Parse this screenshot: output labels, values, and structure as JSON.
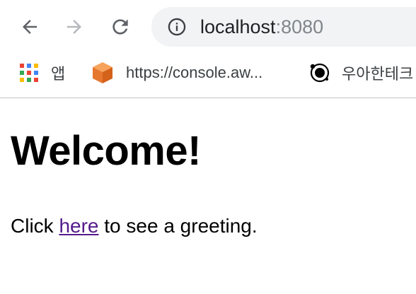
{
  "browser": {
    "address_bar": {
      "host": "localhost",
      "port": ":8080"
    },
    "icon_colors": {
      "back": "#5f6368",
      "forward": "#b6b9bd",
      "reload": "#5f6368"
    },
    "bookmarks": [
      {
        "label": "앱",
        "icon": "apps-grid-icon"
      },
      {
        "label": "https://console.aw...",
        "icon": "aws-cube-icon"
      },
      {
        "label": "우아한테크",
        "icon": "woowa-logo-icon"
      }
    ]
  },
  "page": {
    "heading": "Welcome!",
    "paragraph": {
      "before": "Click ",
      "link": "here",
      "after": " to see a greeting."
    },
    "link_color": "#551a8b"
  }
}
